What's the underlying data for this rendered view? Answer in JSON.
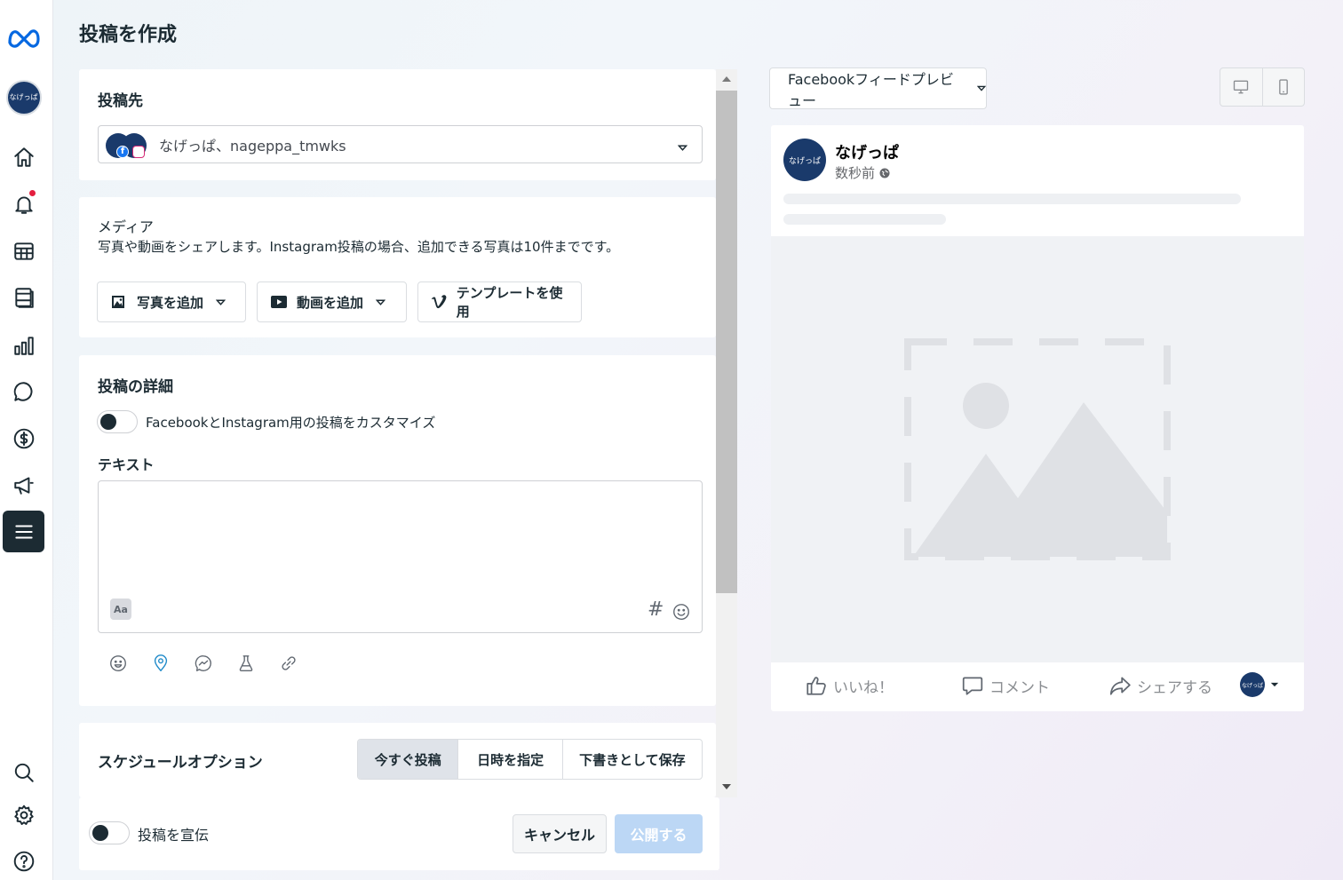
{
  "page": {
    "title": "投稿を作成"
  },
  "sidebar": {
    "brand_icon": "meta-logo-icon",
    "profile_initials": "なげっぱ",
    "items": [
      {
        "icon": "home-icon"
      },
      {
        "icon": "bell-icon",
        "badge": true
      },
      {
        "icon": "table-icon"
      },
      {
        "icon": "pages-icon"
      },
      {
        "icon": "bar-chart-icon"
      },
      {
        "icon": "chat-icon"
      },
      {
        "icon": "dollar-icon"
      },
      {
        "icon": "megaphone-icon"
      },
      {
        "icon": "menu-icon",
        "active": true
      }
    ],
    "bottom_items": [
      {
        "icon": "search-icon"
      },
      {
        "icon": "gear-icon"
      },
      {
        "icon": "help-icon"
      }
    ]
  },
  "destination": {
    "title": "投稿先",
    "selected": "なげっぱ、nageppa_tmwks"
  },
  "media": {
    "title": "メディア",
    "description": "写真や動画をシェアします。Instagram投稿の場合、追加できる写真は10件までです。",
    "buttons": [
      {
        "label": "写真を追加",
        "icon": "photo-icon"
      },
      {
        "label": "動画を追加",
        "icon": "video-icon"
      },
      {
        "label": "テンプレートを使用",
        "icon": "vimeo-icon"
      }
    ]
  },
  "details": {
    "title": "投稿の詳細",
    "customize_label": "FacebookとInstagram用の投稿をカスタマイズ",
    "text_label": "テキスト",
    "text_value": "",
    "hash_symbol": "#",
    "format_badge": "Aa"
  },
  "schedule": {
    "title": "スケジュールオプション",
    "options": [
      "今すぐ投稿",
      "日時を指定",
      "下書きとして保存"
    ],
    "selected": "今すぐ投稿"
  },
  "footer": {
    "boost_label": "投稿を宣伝",
    "cancel_label": "キャンセル",
    "publish_label": "公開する"
  },
  "preview": {
    "placement": "Facebookフィードプレビュー",
    "page_name": "なげっぱ",
    "timestamp": "数秒前",
    "actions": {
      "like": "いいね！",
      "comment": "コメント",
      "share": "シェアする"
    }
  },
  "colors": {
    "primary_dark": "#1c2b33",
    "facebook_blue": "#1877f2",
    "publish_disabled": "#bcd7f5",
    "avatar_navy": "#1a3a6b"
  }
}
